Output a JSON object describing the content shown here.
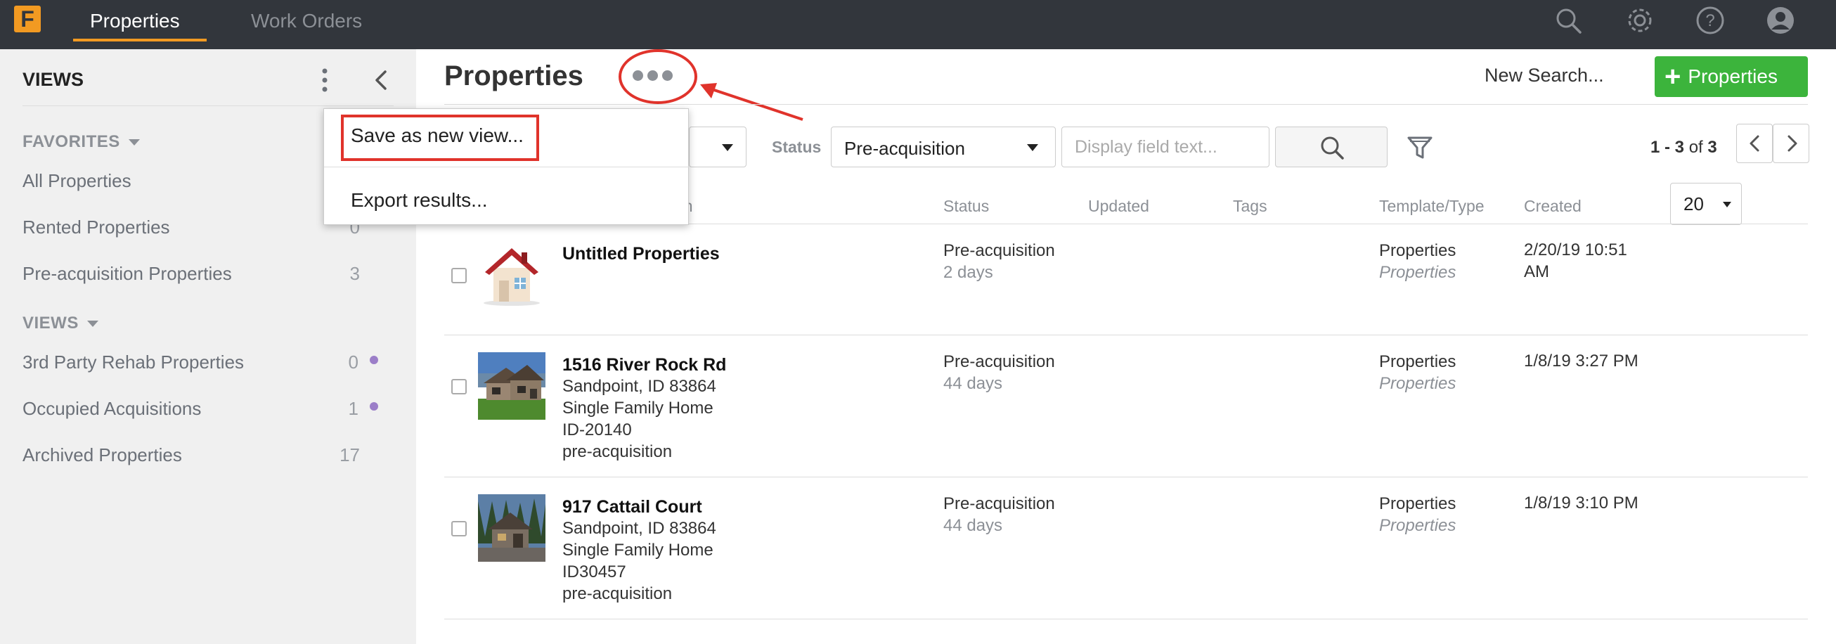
{
  "topbar": {
    "logo_letter": "F",
    "tabs": [
      {
        "label": "Properties",
        "active": true
      },
      {
        "label": "Work Orders",
        "active": false
      }
    ],
    "icons": [
      "search-icon",
      "gear-icon",
      "help-icon",
      "user-icon"
    ],
    "accent_color": "#f29a22"
  },
  "sidebar": {
    "title": "VIEWS",
    "sections": [
      {
        "label": "FAVORITES",
        "items": [
          {
            "label": "All Properties",
            "count": ""
          },
          {
            "label": "Rented Properties",
            "count": "0"
          },
          {
            "label": "Pre-acquisition Properties",
            "count": "3"
          }
        ]
      },
      {
        "label": "VIEWS",
        "items": [
          {
            "label": "3rd Party Rehab Properties",
            "count": "0",
            "dot": true
          },
          {
            "label": "Occupied Acquisitions",
            "count": "1",
            "dot": true
          },
          {
            "label": "Archived Properties",
            "count": "17",
            "dot": false
          }
        ]
      }
    ]
  },
  "main": {
    "title": "Properties",
    "new_search": "New Search...",
    "add_button": "Properties",
    "add_button_color": "#3cb43c",
    "filters": {
      "status_label": "Status",
      "status_value": "Pre-acquisition",
      "display_placeholder": "Display field text..."
    },
    "pager": {
      "range": "1 - 3",
      "of": "of",
      "total": "3"
    },
    "columns": {
      "description_partial": "on",
      "status": "Status",
      "updated": "Updated",
      "tags": "Tags",
      "template": "Template/Type",
      "created": "Created"
    },
    "per_page": "20",
    "rows": [
      {
        "name": "Untitled Properties",
        "lines": [],
        "status": "Pre-acquisition",
        "status_age": "2 days",
        "template": "Properties",
        "type": "Properties",
        "created_line1": "2/20/19 10:51",
        "created_line2": "AM"
      },
      {
        "name": "1516 River Rock Rd",
        "lines": [
          "Sandpoint, ID 83864",
          "Single Family Home",
          "ID-20140",
          "pre-acquisition"
        ],
        "status": "Pre-acquisition",
        "status_age": "44 days",
        "template": "Properties",
        "type": "Properties",
        "created_line1": "1/8/19 3:27 PM",
        "created_line2": ""
      },
      {
        "name": "917 Cattail Court",
        "lines": [
          "Sandpoint, ID 83864",
          "Single Family Home",
          "ID30457",
          "pre-acquisition"
        ],
        "status": "Pre-acquisition",
        "status_age": "44 days",
        "template": "Properties",
        "type": "Properties",
        "created_line1": "1/8/19 3:10 PM",
        "created_line2": ""
      }
    ]
  },
  "menu": {
    "items": [
      {
        "label": "Save as new view..."
      },
      {
        "label": "Export results..."
      }
    ],
    "annotation_color": "#e0332b"
  }
}
